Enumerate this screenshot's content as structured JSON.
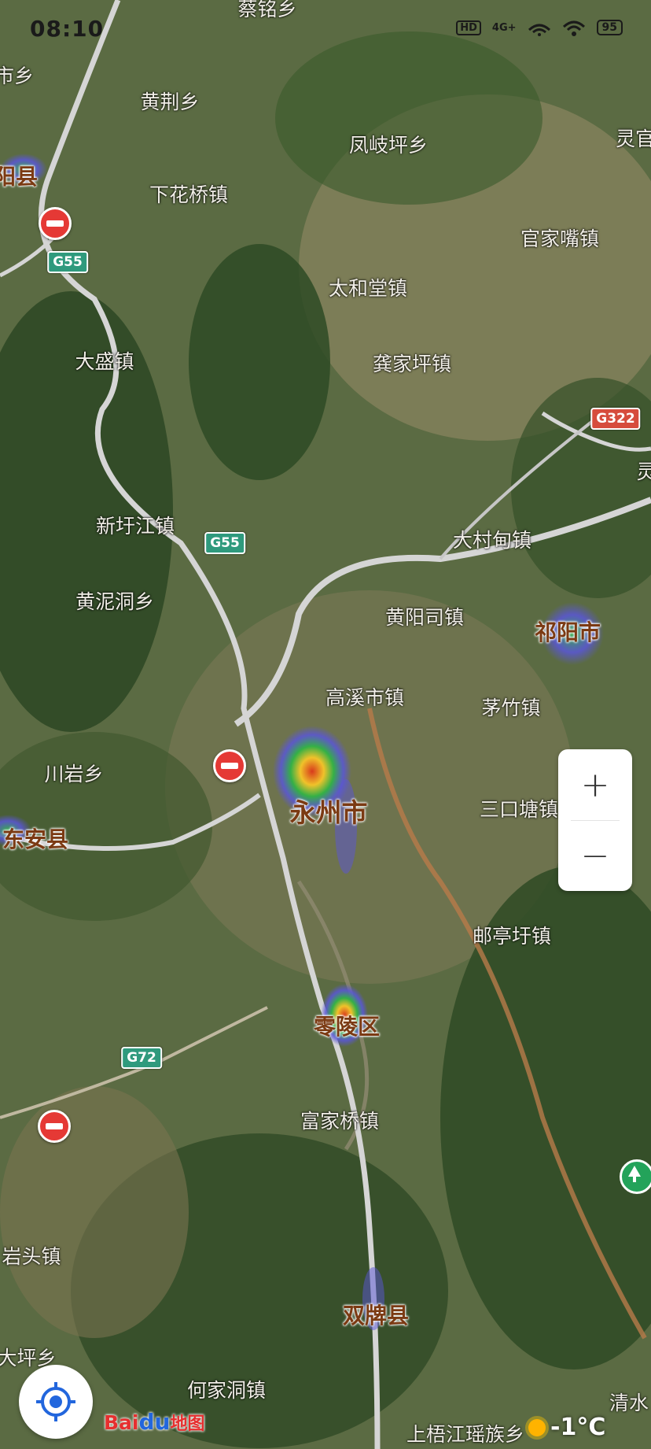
{
  "status_bar": {
    "time": "08:10",
    "network": "4G+",
    "hd": "HD",
    "battery": "95"
  },
  "map": {
    "places": [
      {
        "id": "p1",
        "text": "蔡铭乡"
      },
      {
        "id": "p2",
        "text": "市乡"
      },
      {
        "id": "p3",
        "text": "黄荆乡"
      },
      {
        "id": "p4",
        "text": "凤岐坪乡"
      },
      {
        "id": "p5",
        "text": "灵官"
      },
      {
        "id": "p6",
        "text": "阳县"
      },
      {
        "id": "p7",
        "text": "下花桥镇"
      },
      {
        "id": "p8",
        "text": "官家嘴镇"
      },
      {
        "id": "p9",
        "text": "太和堂镇"
      },
      {
        "id": "p10",
        "text": "大盛镇"
      },
      {
        "id": "p11",
        "text": "龚家坪镇"
      },
      {
        "id": "p12",
        "text": "新圩江镇"
      },
      {
        "id": "p13",
        "text": "大村甸镇"
      },
      {
        "id": "p14",
        "text": "黄泥洞乡"
      },
      {
        "id": "p15",
        "text": "黄阳司镇"
      },
      {
        "id": "p16",
        "text": "祁阳市"
      },
      {
        "id": "p17",
        "text": "高溪市镇"
      },
      {
        "id": "p18",
        "text": "茅竹镇"
      },
      {
        "id": "p19",
        "text": "川岩乡"
      },
      {
        "id": "p20",
        "text": "永州市"
      },
      {
        "id": "p21",
        "text": "三口塘镇"
      },
      {
        "id": "p22",
        "text": "东安县"
      },
      {
        "id": "p23",
        "text": "邮亭圩镇"
      },
      {
        "id": "p24",
        "text": "零陵区"
      },
      {
        "id": "p25",
        "text": "富家桥镇"
      },
      {
        "id": "p26",
        "text": "岩头镇"
      },
      {
        "id": "p27",
        "text": "双牌县"
      },
      {
        "id": "p28",
        "text": "大坪乡"
      },
      {
        "id": "p29",
        "text": "何家洞镇"
      },
      {
        "id": "p30",
        "text": "清水"
      },
      {
        "id": "p31",
        "text": "上梧江瑶族乡"
      },
      {
        "id": "p32",
        "text": "灵"
      }
    ],
    "road_shields": [
      {
        "id": "s1",
        "text": "G55"
      },
      {
        "id": "s2",
        "text": "G322"
      },
      {
        "id": "s3",
        "text": "G55"
      },
      {
        "id": "s4",
        "text": "G72"
      }
    ]
  },
  "controls": {
    "zoom_in": "+",
    "zoom_out": "−"
  },
  "logo": {
    "bai": "Bai",
    "du": "du",
    "cn": "地图"
  },
  "weather": {
    "temp": "-1°C"
  },
  "colors": {
    "accent": "#2266dd",
    "city_label": "#7b3a13",
    "shield_green": "#2f9a7d",
    "shield_red": "#d64c3d"
  }
}
